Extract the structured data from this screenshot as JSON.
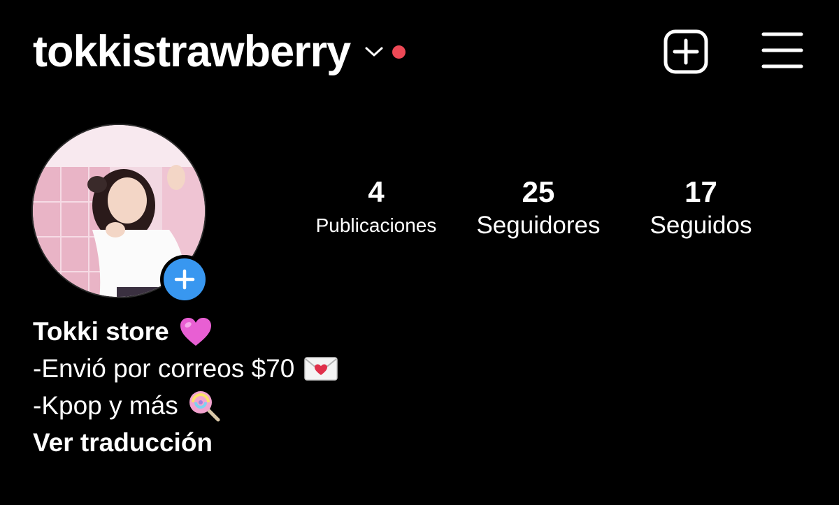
{
  "header": {
    "username": "tokkistrawberry",
    "icons": {
      "dropdown": "chevron-down-icon",
      "notification_dot": "notification-dot",
      "new_post": "plus-square-icon",
      "menu": "hamburger-menu-icon"
    },
    "colors": {
      "notification_dot": "#ED4956"
    }
  },
  "profile": {
    "avatar_icon": "avatar-photo",
    "add_story_icon": "plus-icon",
    "colors": {
      "add_story": "#3897F0"
    },
    "stats": {
      "posts": {
        "count": "4",
        "label": "Publicaciones"
      },
      "followers": {
        "count": "25",
        "label": "Seguidores"
      },
      "following": {
        "count": "17",
        "label": "Seguidos"
      }
    }
  },
  "bio": {
    "name": "Tokki store",
    "name_emoji": "heart-emoji",
    "lines": [
      {
        "text": "-Envió por correos $70",
        "emoji": "love-letter-emoji"
      },
      {
        "text": "-Kpop y más",
        "emoji": "lollipop-emoji"
      }
    ],
    "translate_link": "Ver traducción"
  }
}
